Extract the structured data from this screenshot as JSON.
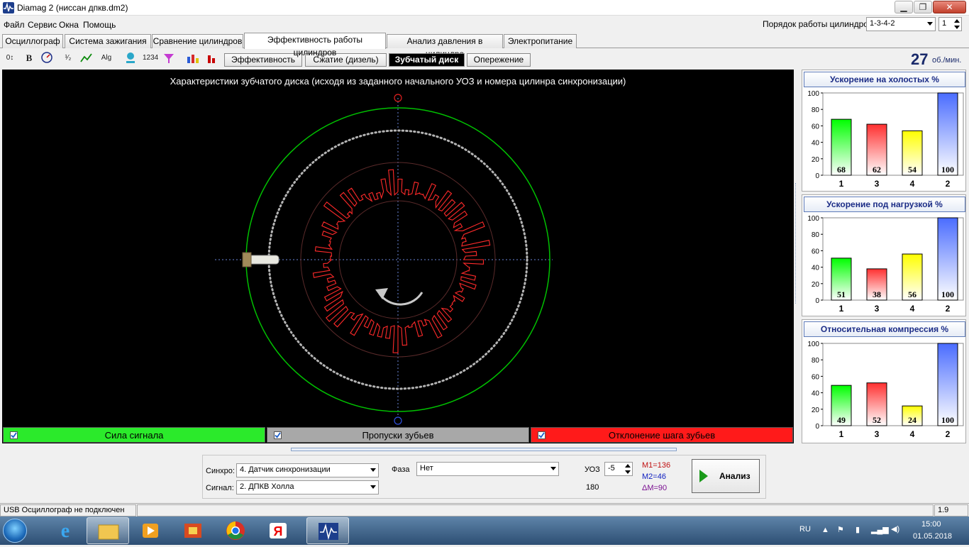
{
  "window": {
    "title": "Diamag 2 (ниссан дпкв.dm2)",
    "controls": [
      "minimize",
      "maximize",
      "close"
    ]
  },
  "menu": [
    "Файл",
    "Сервис",
    "Окна",
    "Помощь"
  ],
  "cylinder_order": {
    "label": "Порядок работы цилиндров",
    "value": "1-3-4-2",
    "spin": "1"
  },
  "tabs": [
    "Осциллограф",
    "Система зажигания",
    "Сравнение цилиндров",
    "Эффективность работы цилиндров",
    "Анализ давления в цилиндре",
    "Электропитание"
  ],
  "active_tab": "Эффективность работы цилиндров",
  "toolbar_icons": [
    "zero-offset-icon",
    "bold-icon",
    "rpm-meter-icon",
    "scale-icon",
    "curve-icon",
    "alg-icon",
    "network-icon",
    "counter-icon",
    "filter-icon",
    "people-icon",
    "bar-chart-icon"
  ],
  "subtabs": [
    "Эффективность",
    "Сжатие (дизель)",
    "Зубчатый диск",
    "Опережение"
  ],
  "active_subtab": "Зубчатый диск",
  "rpm": {
    "value": "27",
    "unit": "об./мин."
  },
  "scope": {
    "title": "Характеристики зубчатого диска (исходя из заданного начального УОЗ и номера цилинра синхронизации)"
  },
  "legend": {
    "signal_strength": {
      "label": "Сила сигнала",
      "color": "#00ff00",
      "checked": true
    },
    "missed_teeth": {
      "label": "Пропуски зубьев",
      "color": "#a8a8a8",
      "checked": true
    },
    "tooth_pitch": {
      "label": "Отклонение шага зубьев",
      "color": "#ff0000",
      "checked": true
    }
  },
  "panels": [
    {
      "title": "Ускорение на холостых %",
      "ylim": [
        0,
        100
      ],
      "yticks": [
        "100",
        "80",
        "60",
        "40",
        "20",
        "0"
      ]
    },
    {
      "title": "Ускорение под нагрузкой %",
      "ylim": [
        0,
        100
      ],
      "yticks": [
        "100",
        "80",
        "60",
        "40",
        "20",
        "0"
      ]
    },
    {
      "title": "Относительная компрессия %",
      "ylim": [
        0,
        100
      ],
      "yticks": [
        "100",
        "80",
        "60",
        "40",
        "20",
        "0"
      ]
    }
  ],
  "chart_data": [
    {
      "type": "bar",
      "title": "Ускорение на холостых %",
      "categories": [
        "1",
        "3",
        "4",
        "2"
      ],
      "values": [
        68,
        62,
        54,
        100
      ],
      "labels": [
        "68",
        "62",
        "54",
        "100"
      ],
      "colors": [
        "#00ff00",
        "#ff3030",
        "#ffff00",
        "#4a6cff"
      ],
      "ylim": [
        0,
        100
      ]
    },
    {
      "type": "bar",
      "title": "Ускорение под нагрузкой %",
      "categories": [
        "1",
        "3",
        "4",
        "2"
      ],
      "values": [
        51,
        38,
        56,
        100
      ],
      "labels": [
        "51",
        "38",
        "56",
        "100"
      ],
      "colors": [
        "#00ff00",
        "#ff3030",
        "#ffff00",
        "#4a6cff"
      ],
      "ylim": [
        0,
        100
      ]
    },
    {
      "type": "bar",
      "title": "Относительная компрессия %",
      "categories": [
        "1",
        "3",
        "4",
        "2"
      ],
      "values": [
        49,
        52,
        24,
        100
      ],
      "labels": [
        "49",
        "52",
        "24",
        "100"
      ],
      "colors": [
        "#00ff00",
        "#ff3030",
        "#ffff00",
        "#4a6cff"
      ],
      "ylim": [
        0,
        100
      ]
    }
  ],
  "bottom": {
    "sync_label": "Синхро:",
    "sync_value": "4.  Датчик синхронизации",
    "signal_label": "Сигнал:",
    "signal_value": "2.  ДПКВ Холла",
    "phase_label": "Фаза",
    "phase_value": "Нет",
    "uoz_label": "УОЗ",
    "uoz_value": "-5",
    "angle_value": "180",
    "m1": "M1=136",
    "m2": "M2=46",
    "dm": "ΔM=90",
    "analyze_label": "Анализ"
  },
  "status": {
    "left": "USB Осциллограф не подключен",
    "right": "1.9"
  },
  "taskbar": {
    "apps": [
      "start-orb",
      "ie-icon",
      "explorer-icon",
      "media-player-icon",
      "network-tool-icon",
      "chrome-icon",
      "yandex-icon",
      "diamag-icon"
    ],
    "lang": "RU",
    "time": "15:00",
    "date": "01.05.2018"
  },
  "colors": {
    "scope_bg": "#000000",
    "outer_ring": "#00c000",
    "tooth_trace": "#ff3030",
    "accent_blue": "#1b2c86"
  }
}
